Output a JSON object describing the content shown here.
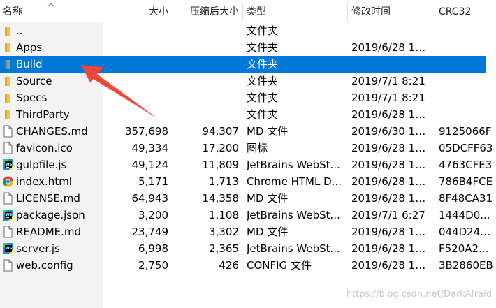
{
  "columns": {
    "name": "名称",
    "size": "大小",
    "packed": "压缩后大小",
    "type": "类型",
    "modified": "修改时间",
    "crc": "CRC32"
  },
  "rows": [
    {
      "name": "..",
      "size": "",
      "packed": "",
      "type": "文件夹",
      "modified": "",
      "crc": "",
      "icon": "folder-icon"
    },
    {
      "name": "Apps",
      "size": "",
      "packed": "",
      "type": "文件夹",
      "modified": "2019/6/28 11:...",
      "crc": "",
      "icon": "folder-icon"
    },
    {
      "name": "Build",
      "size": "",
      "packed": "",
      "type": "文件夹",
      "modified": "",
      "crc": "",
      "icon": "folder-icon",
      "selected": true
    },
    {
      "name": "Source",
      "size": "",
      "packed": "",
      "type": "文件夹",
      "modified": "2019/7/1 8:21",
      "crc": "",
      "icon": "folder-icon"
    },
    {
      "name": "Specs",
      "size": "",
      "packed": "",
      "type": "文件夹",
      "modified": "2019/7/1 8:21",
      "crc": "",
      "icon": "folder-icon"
    },
    {
      "name": "ThirdParty",
      "size": "",
      "packed": "",
      "type": "文件夹",
      "modified": "2019/6/28 11:...",
      "crc": "",
      "icon": "folder-icon"
    },
    {
      "name": "CHANGES.md",
      "size": "357,698",
      "packed": "94,307",
      "type": "MD 文件",
      "modified": "2019/6/30 19:...",
      "crc": "9125066F",
      "icon": "document-icon"
    },
    {
      "name": "favicon.ico",
      "size": "49,334",
      "packed": "17,200",
      "type": "图标",
      "modified": "2019/6/28 11:...",
      "crc": "05DCFF63",
      "icon": "document-icon"
    },
    {
      "name": "gulpfile.js",
      "size": "49,124",
      "packed": "11,809",
      "type": "JetBrains WebSt...",
      "modified": "2019/6/28 11:...",
      "crc": "4763CFE3",
      "icon": "webstorm-icon"
    },
    {
      "name": "index.html",
      "size": "5,171",
      "packed": "1,713",
      "type": "Chrome HTML D...",
      "modified": "2019/6/28 11:...",
      "crc": "786B4FCE",
      "icon": "chrome-icon"
    },
    {
      "name": "LICENSE.md",
      "size": "64,943",
      "packed": "14,358",
      "type": "MD 文件",
      "modified": "2019/6/28 11:...",
      "crc": "8F48CA31",
      "icon": "document-icon"
    },
    {
      "name": "package.json",
      "size": "3,200",
      "packed": "1,108",
      "type": "JetBrains WebSt...",
      "modified": "2019/7/1 6:27",
      "crc": "1444D0...",
      "icon": "webstorm-icon"
    },
    {
      "name": "README.md",
      "size": "23,749",
      "packed": "3,302",
      "type": "MD 文件",
      "modified": "2019/6/28 11:...",
      "crc": "044D2453",
      "icon": "document-icon"
    },
    {
      "name": "server.js",
      "size": "6,998",
      "packed": "2,365",
      "type": "JetBrains WebSt...",
      "modified": "2019/6/28 11:...",
      "crc": "F520A2...",
      "icon": "webstorm-icon"
    },
    {
      "name": "web.config",
      "size": "2,750",
      "packed": "426",
      "type": "CONFIG 文件",
      "modified": "2019/6/28 11:...",
      "crc": "3B2860EB",
      "icon": "document-icon"
    }
  ],
  "watermark": "https://blog.csdn.net/DarkAfraid",
  "colors": {
    "selection": "#0078d7",
    "folder": "#f6c243",
    "arrow": "#f0473c"
  }
}
